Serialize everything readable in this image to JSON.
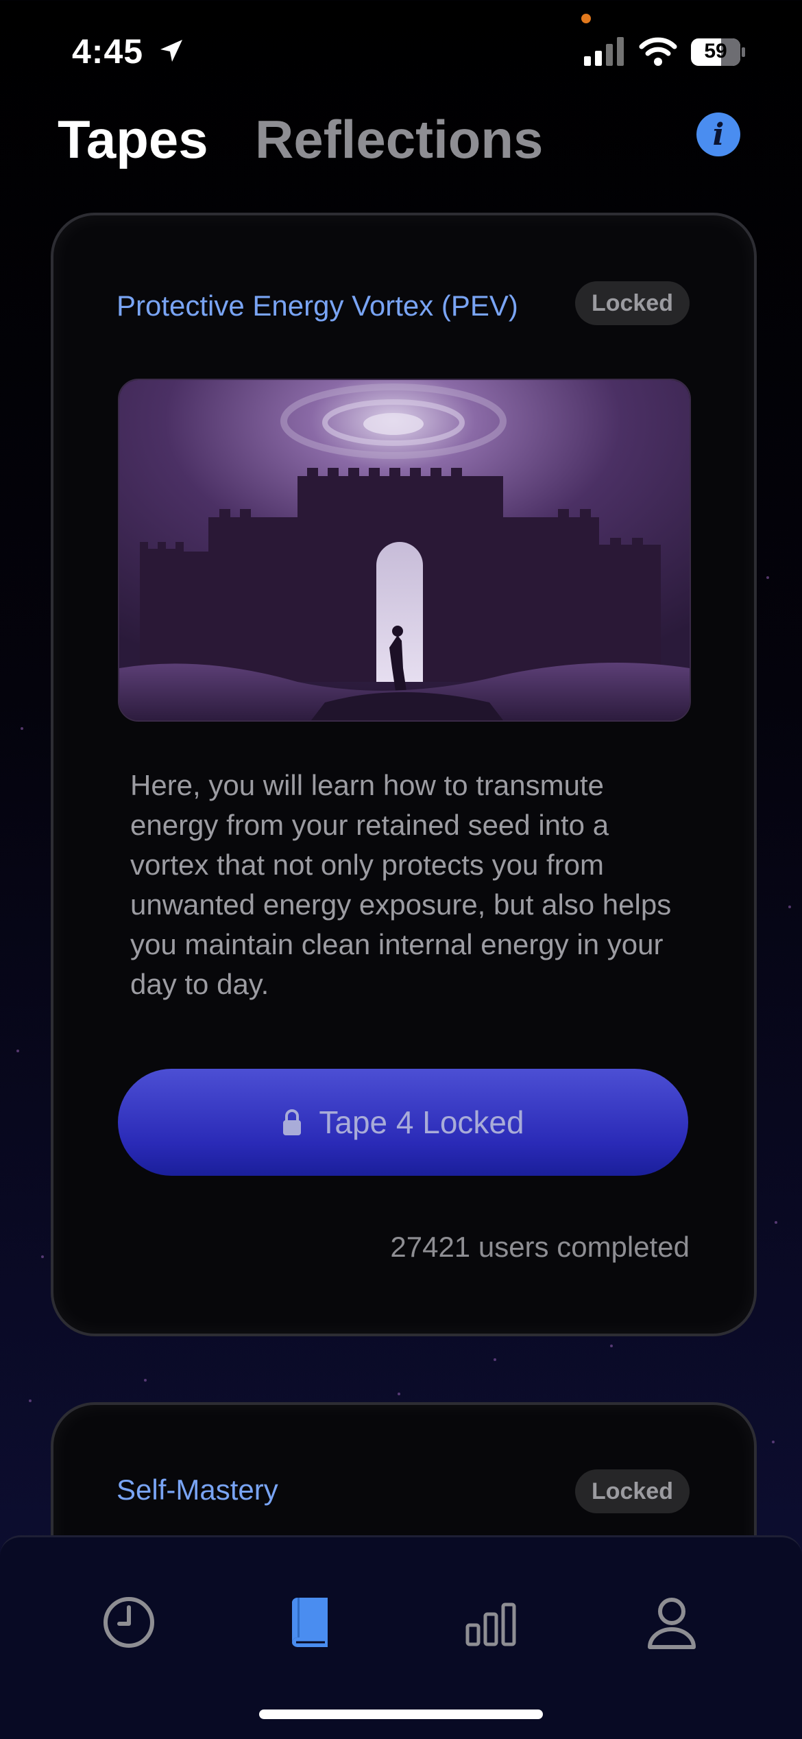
{
  "status_bar": {
    "time": "4:45",
    "battery": "59",
    "icons": [
      "location-arrow-icon",
      "cellular-signal-icon",
      "wifi-icon",
      "battery-icon"
    ]
  },
  "header": {
    "tabs": [
      {
        "label": "Tapes",
        "active": true
      },
      {
        "label": "Reflections",
        "active": false
      }
    ],
    "info_icon": "info-icon",
    "info_glyph": "i"
  },
  "cards": [
    {
      "title": "Protective Energy Vortex (PEV)",
      "badge": "Locked",
      "image": "castle-vortex-artwork",
      "description": "Here, you will learn how to transmute energy from your retained seed into a vortex that not only protects you from unwanted energy exposure, but also helps you maintain clean internal energy in your day to day.",
      "button_label": "Tape 4 Locked",
      "completed": "27421 users completed"
    },
    {
      "title": "Self-Mastery",
      "badge": "Locked"
    }
  ],
  "tab_bar": {
    "items": [
      {
        "icon": "clock-icon",
        "active": false
      },
      {
        "icon": "book-icon",
        "active": true
      },
      {
        "icon": "bar-chart-icon",
        "active": false
      },
      {
        "icon": "profile-icon",
        "active": false
      }
    ]
  },
  "colors": {
    "accent": "#4a8df0",
    "title_blue": "#79a4f4",
    "button_top": "#4c4fd4",
    "button_bottom": "#1a1f9a"
  }
}
